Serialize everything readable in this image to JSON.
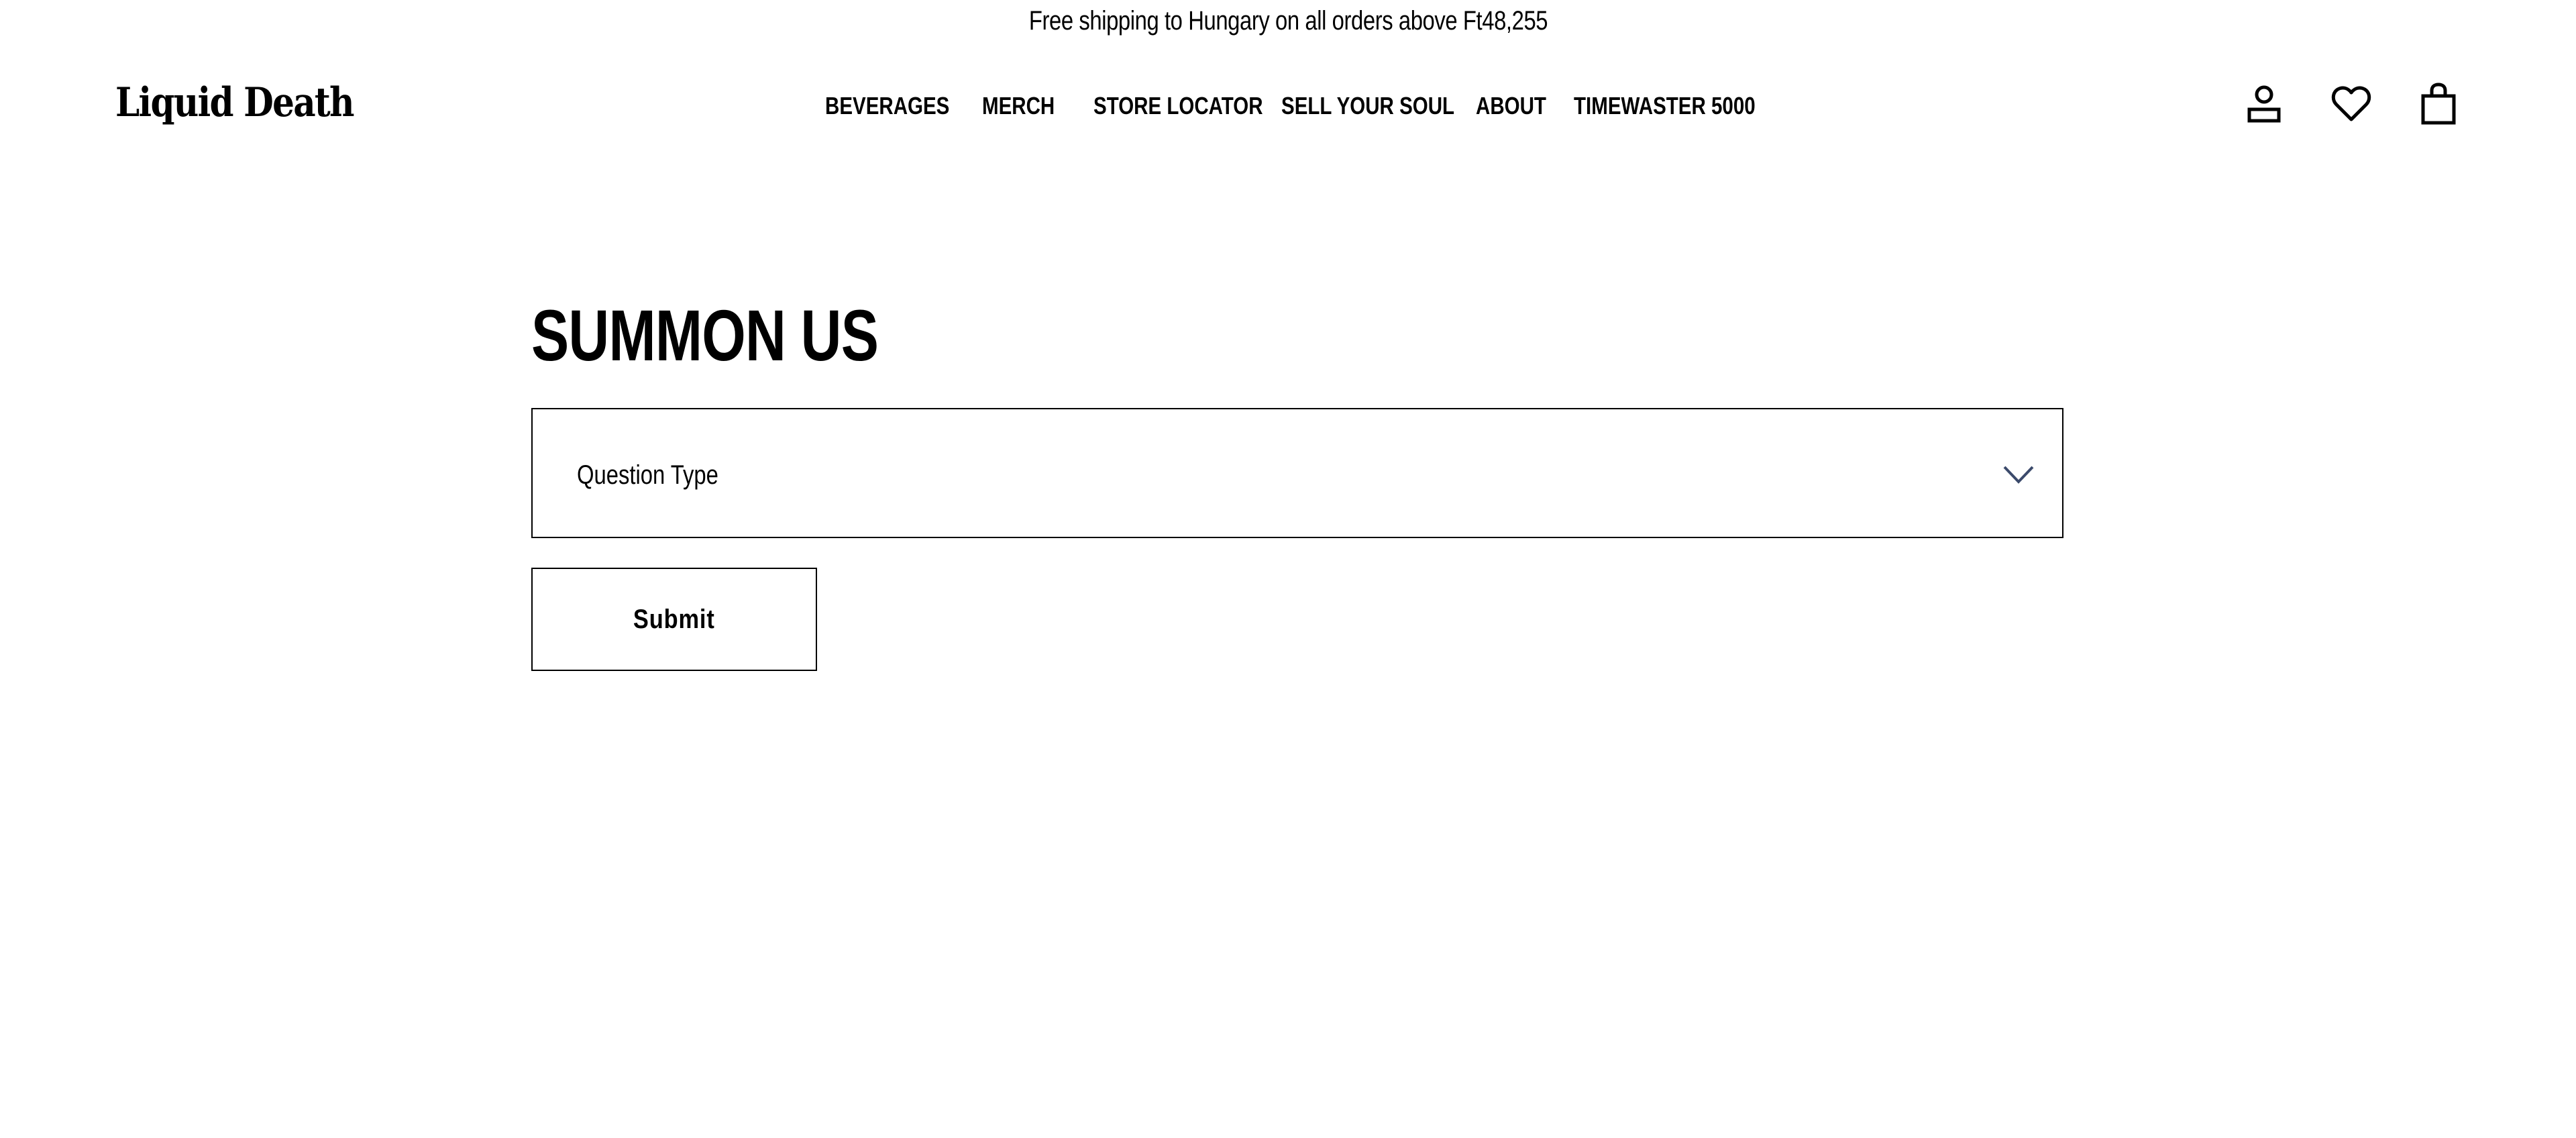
{
  "announcement": {
    "text": "Free shipping to Hungary on all orders above Ft48,255"
  },
  "header": {
    "logo_text": "Liquid Death",
    "nav": [
      {
        "label": "BEVERAGES"
      },
      {
        "label": "MERCH"
      },
      {
        "label": "STORE LOCATOR"
      },
      {
        "label": "SELL YOUR SOUL"
      },
      {
        "label": "ABOUT"
      },
      {
        "label": "TIMEWASTER 5000"
      }
    ],
    "icons": [
      "account-icon",
      "heart-icon",
      "shopping-bag-icon"
    ]
  },
  "main": {
    "title": "SUMMON US",
    "question_type": {
      "placeholder": "Question Type",
      "icon": "chevron-down-icon",
      "chevron_color": "#3b4a6b"
    },
    "submit_label": "Submit"
  },
  "colors": {
    "text": "#000000",
    "background": "#ffffff",
    "border": "#000000"
  }
}
